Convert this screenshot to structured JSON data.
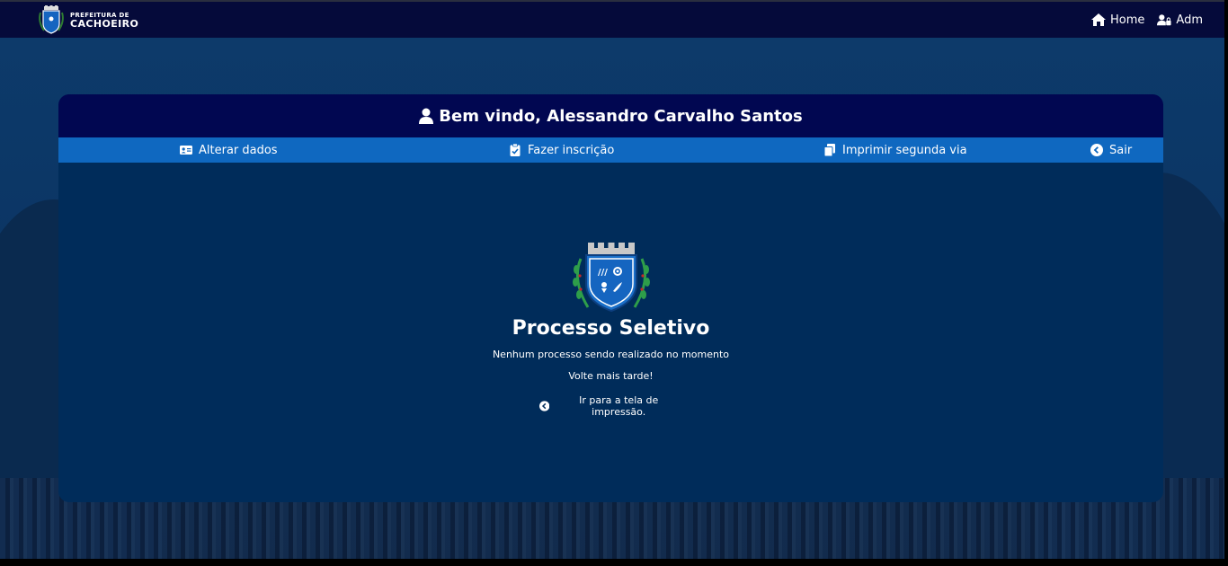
{
  "header": {
    "brand_line1": "PREFEITURA DE",
    "brand_line2": "CACHOEIRO",
    "nav": [
      {
        "label": "Home",
        "icon": "home-icon"
      },
      {
        "label": "Adm",
        "icon": "user-lock-icon"
      }
    ]
  },
  "panel": {
    "welcome": "Bem vindo, Alessandro Carvalho Santos",
    "menu": [
      {
        "label": "Alterar dados",
        "icon": "id-card-icon"
      },
      {
        "label": "Fazer inscrição",
        "icon": "clipboard-check-icon"
      },
      {
        "label": "Imprimir segunda via",
        "icon": "copy-icon"
      },
      {
        "label": "Sair",
        "icon": "chevron-circle-left-icon"
      }
    ]
  },
  "content": {
    "title": "Processo Seletivo",
    "message": "Nenhum processo sendo realizado no momento",
    "hint": "Volte mais tarde!",
    "back_link": "Ir para a tela de impressão."
  },
  "colors": {
    "topbar": "#050a3a",
    "panel_header": "#010751",
    "menu_bar": "#0f68c0",
    "panel_body": "#002c5a"
  }
}
